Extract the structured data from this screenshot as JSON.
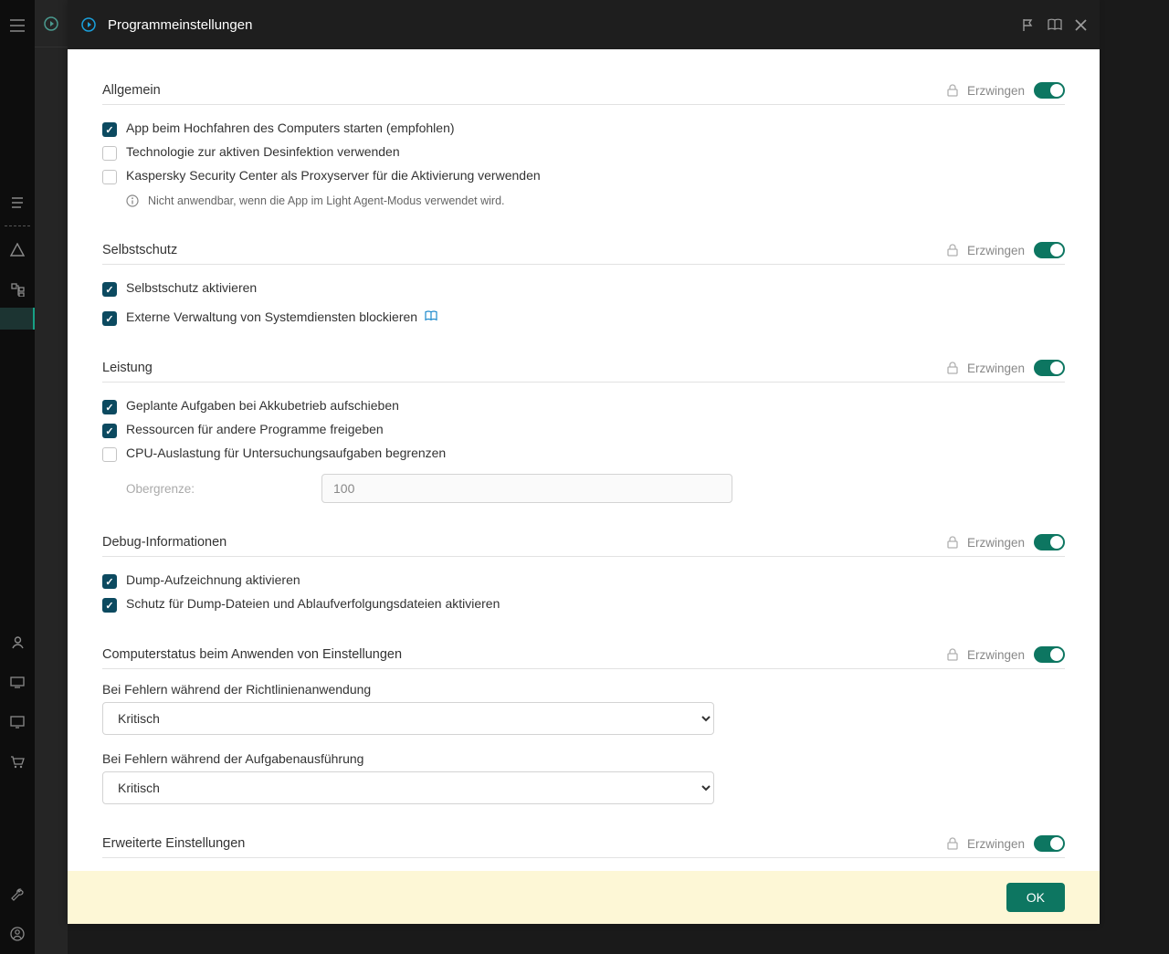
{
  "header": {
    "title": "Programmeinstellungen"
  },
  "sections": {
    "general": {
      "title": "Allgemein",
      "enforce": "Erzwingen",
      "opt1": "App beim Hochfahren des Computers starten (empfohlen)",
      "opt2": "Technologie zur aktiven Desinfektion verwenden",
      "opt3": "Kaspersky Security Center als Proxyserver für die Aktivierung verwenden",
      "info": "Nicht anwendbar, wenn die App im Light Agent-Modus verwendet wird."
    },
    "self_protection": {
      "title": "Selbstschutz",
      "enforce": "Erzwingen",
      "opt1": "Selbstschutz aktivieren",
      "opt2": "Externe Verwaltung von Systemdiensten blockieren"
    },
    "performance": {
      "title": "Leistung",
      "enforce": "Erzwingen",
      "opt1": "Geplante Aufgaben bei Akkubetrieb aufschieben",
      "opt2": "Ressourcen für andere Programme freigeben",
      "opt3": "CPU-Auslastung für Untersuchungsaufgaben begrenzen",
      "upper_limit_label": "Obergrenze:",
      "upper_limit_value": "100"
    },
    "debug": {
      "title": "Debug-Informationen",
      "enforce": "Erzwingen",
      "opt1": "Dump-Aufzeichnung aktivieren",
      "opt2": "Schutz für Dump-Dateien und Ablaufverfolgungsdateien aktivieren"
    },
    "computer_status": {
      "title": "Computerstatus beim Anwenden von Einstellungen",
      "enforce": "Erzwingen",
      "select1_label": "Bei Fehlern während der Richtlinienanwendung",
      "select1_value": "Kritisch",
      "select2_label": "Bei Fehlern während der Aufgabenausführung",
      "select2_value": "Kritisch"
    },
    "advanced": {
      "title": "Erweiterte Einstellungen",
      "enforce": "Erzwingen"
    }
  },
  "footer": {
    "ok": "OK"
  }
}
